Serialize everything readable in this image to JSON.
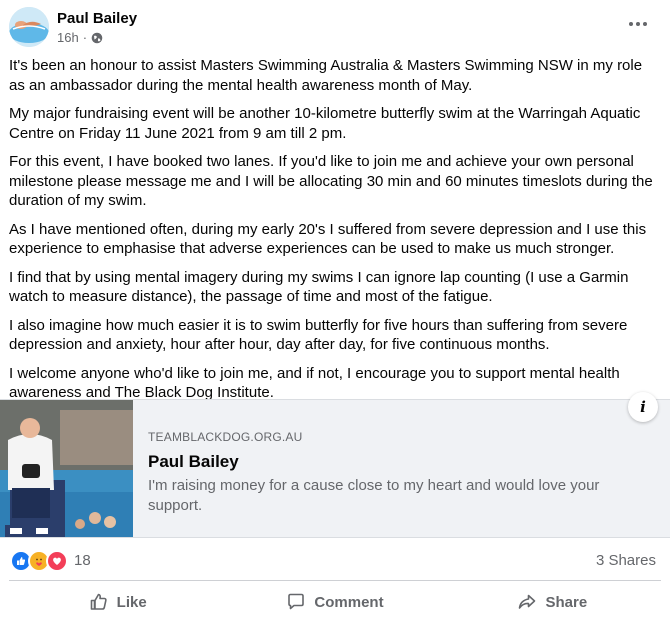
{
  "post": {
    "author": "Paul Bailey",
    "time": "16h",
    "separator": "·",
    "paragraphs": [
      "It's been an honour to assist Masters Swimming Australia & Masters Swimming NSW in my role as an ambassador during the mental health awareness month of May.",
      "My major fundraising event will be another 10-kilometre butterfly swim at the Warringah Aquatic Centre on Friday 11 June 2021 from 9 am till 2 pm.",
      "For this event, I have booked two lanes. If you'd like to join me and achieve your own personal milestone please message me and I will be allocating 30 min and 60 minutes timeslots during the duration of my swim.",
      "As I have mentioned often, during my early 20's I suffered from severe depression and I use this experience to emphasise that adverse experiences can be used to make us much stronger.",
      "I find that by using mental imagery during my swims I can ignore lap counting (I use a Garmin watch to measure distance), the passage of time and most of the fatigue.",
      "I also imagine how much easier it is to swim butterfly for five hours than suffering from severe depression and anxiety, hour after hour, day after day, for five continuous months.",
      "I welcome anyone who'd like to join me, and if not, I encourage you to support mental health awareness and The Black Dog Institute."
    ]
  },
  "link_preview": {
    "domain": "TEAMBLACKDOG.ORG.AU",
    "title": "Paul Bailey",
    "description": "I'm raising money for a cause close to my heart and would love your support.",
    "info_label": "i"
  },
  "reactions": {
    "icons": [
      "like-icon",
      "care-icon",
      "love-icon"
    ],
    "count": "18",
    "shares": "3 Shares"
  },
  "actions": {
    "like": "Like",
    "comment": "Comment",
    "share": "Share"
  },
  "colors": {
    "like_blue": "#1877f2",
    "love_red": "#f33e58",
    "care_yellow": "#f7b125",
    "muted_text": "#65676b",
    "preview_bg": "#f0f2f5"
  }
}
